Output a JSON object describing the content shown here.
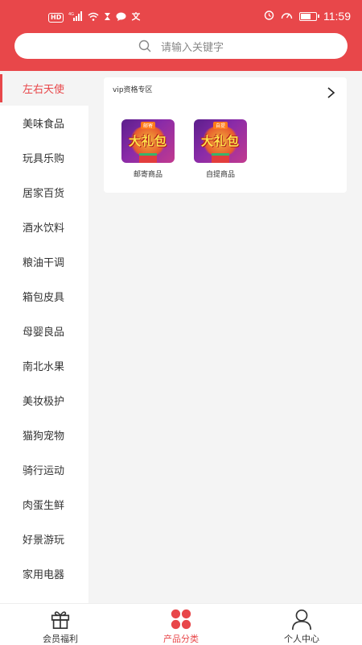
{
  "status": {
    "time": "11:59",
    "left_icons": [
      "hd-badge",
      "4g-signal-icon",
      "wifi-icon",
      "hourglass-icon",
      "chat-icon",
      "translate-icon"
    ],
    "right_icons": [
      "alarm-icon",
      "speedometer-icon",
      "battery-icon"
    ],
    "hd_label": "HD",
    "network_label": "4G"
  },
  "search": {
    "placeholder": "请输入关键字"
  },
  "sidebar": {
    "items": [
      {
        "label": "左右天使",
        "active": true
      },
      {
        "label": "美味食品"
      },
      {
        "label": "玩具乐购"
      },
      {
        "label": "居家百货"
      },
      {
        "label": "酒水饮料"
      },
      {
        "label": "粮油干调"
      },
      {
        "label": "箱包皮具"
      },
      {
        "label": "母婴良品"
      },
      {
        "label": "南北水果"
      },
      {
        "label": "美妆极护"
      },
      {
        "label": "猫狗宠物"
      },
      {
        "label": "骑行运动"
      },
      {
        "label": "肉蛋生鲜"
      },
      {
        "label": "好景游玩"
      },
      {
        "label": "家用电器"
      }
    ]
  },
  "content": {
    "section_title": "vip资格专区",
    "items": [
      {
        "label": "邮寄商品",
        "image_text": "大礼包",
        "image_tag": "邮寄"
      },
      {
        "label": "自提商品",
        "image_text": "大礼包",
        "image_tag": "自提"
      }
    ]
  },
  "bottom_nav": {
    "items": [
      {
        "label": "会员福利",
        "icon": "gift-icon"
      },
      {
        "label": "产品分类",
        "icon": "category-icon",
        "active": true
      },
      {
        "label": "个人中心",
        "icon": "person-icon"
      }
    ]
  },
  "colors": {
    "accent": "#e8474a",
    "background": "#f4f4f4"
  }
}
